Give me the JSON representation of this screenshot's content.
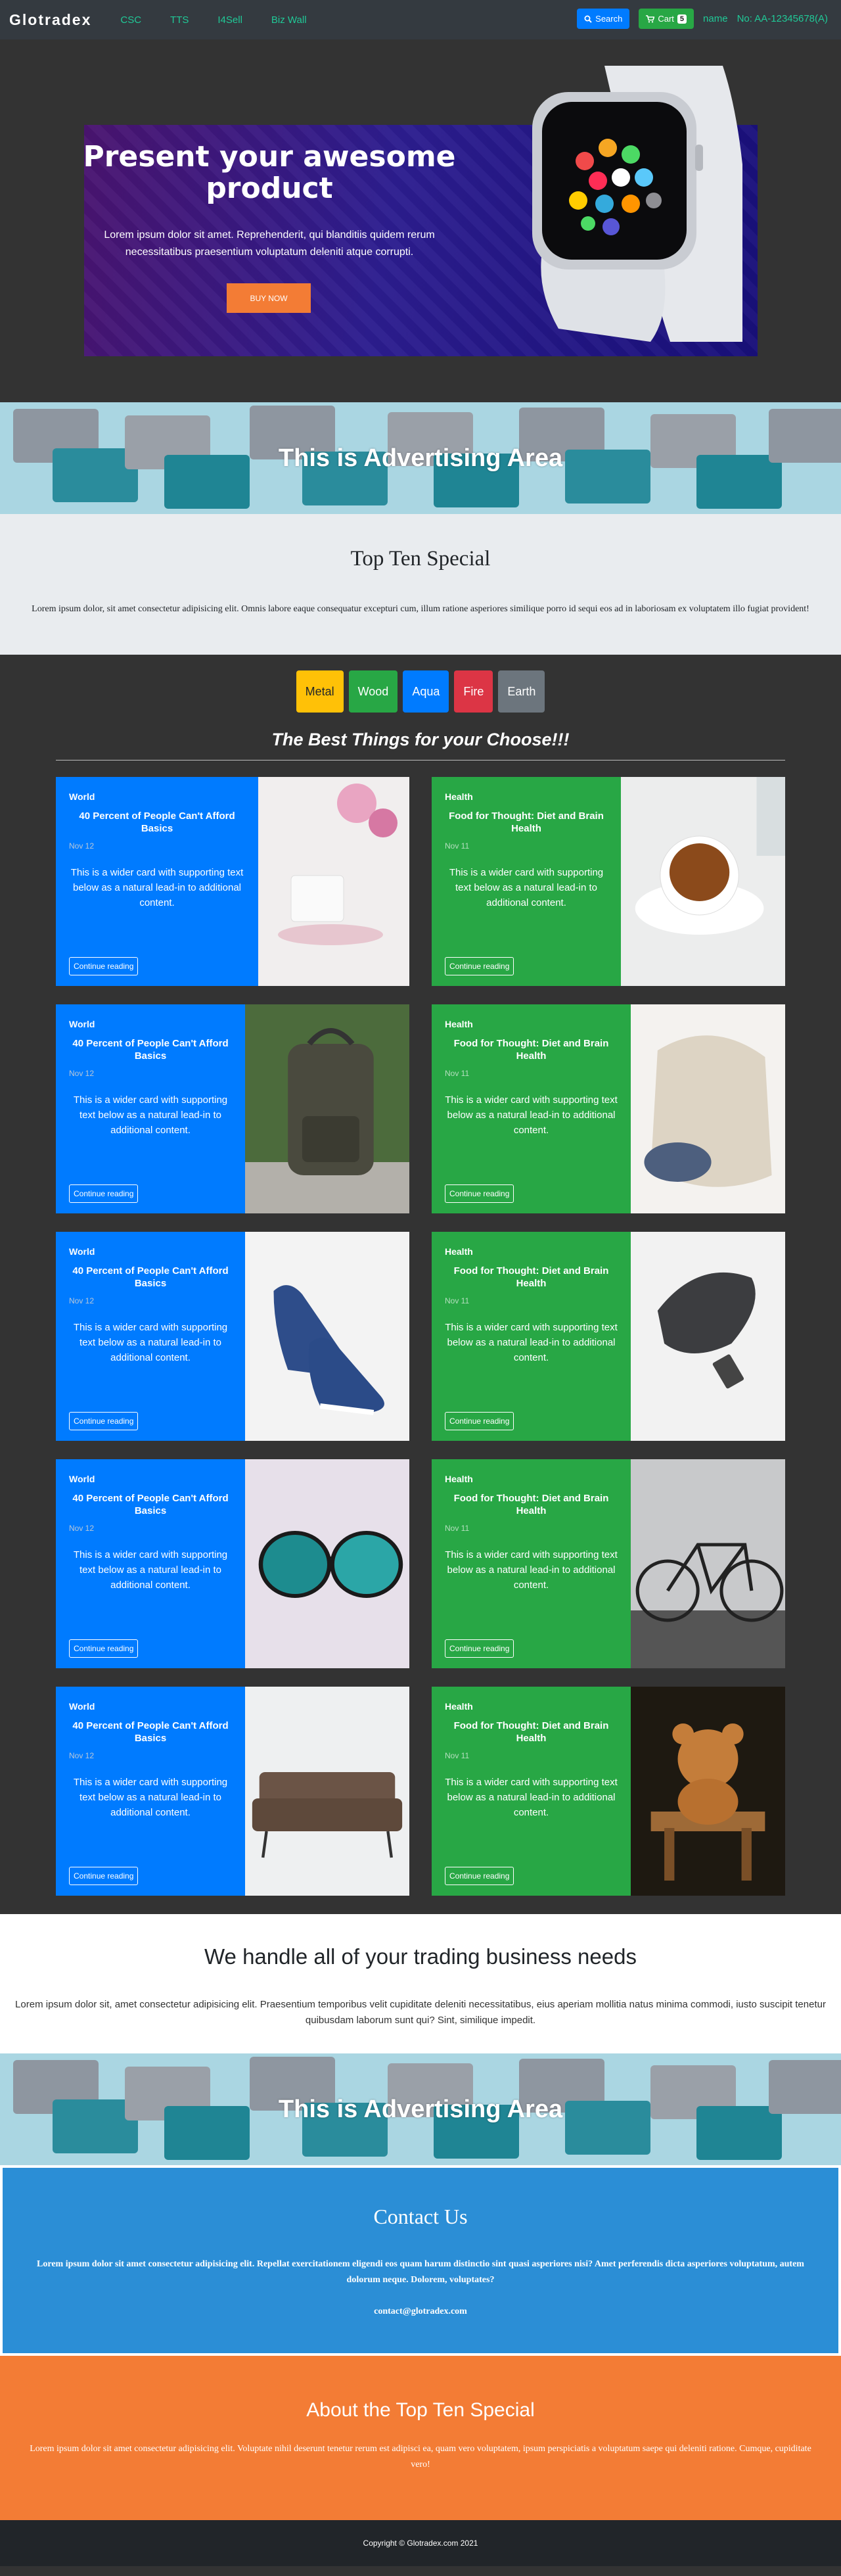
{
  "nav": {
    "brand": "Glotradex",
    "links": [
      "CSC",
      "TTS",
      "I4Sell",
      "Biz Wall"
    ],
    "search_label": "Search",
    "cart_label": "Cart",
    "cart_count": "5",
    "user_name": "name",
    "account_no": "No: AA-12345678(A)"
  },
  "hero": {
    "title": "Present your awesome product",
    "text": "Lorem ipsum dolor sit amet. Reprehenderit, qui blanditiis quidem rerum necessitatibus praesentium voluptatum deleniti atque corrupti.",
    "button": "BUY NOW"
  },
  "ad": {
    "title": "This is Advertising Area"
  },
  "topten": {
    "title": "Top Ten Special",
    "text": "Lorem ipsum dolor, sit amet consectetur adipisicing elit. Omnis labore eaque consequatur excepturi cum, illum ratione asperiores similique porro id sequi eos ad in laboriosam ex voluptatem illo fugiat provident!"
  },
  "tags": [
    {
      "label": "Metal",
      "color": "#ffc107",
      "text": "#212529"
    },
    {
      "label": "Wood",
      "color": "#28a745",
      "text": "#ffffff"
    },
    {
      "label": "Aqua",
      "color": "#007bff",
      "text": "#ffffff"
    },
    {
      "label": "Fire",
      "color": "#dc3545",
      "text": "#ffffff"
    },
    {
      "label": "Earth",
      "color": "#6c757d",
      "text": "#ffffff"
    }
  ],
  "best_title": "The Best Things for your Choose!!!",
  "cards": [
    {
      "category": "World",
      "title": "40 Percent of People Can't Afford Basics",
      "date": "Nov 12",
      "text": "This is a wider card with supporting text below as a natural lead-in to additional content.",
      "button": "Continue reading",
      "image": "cup-photo"
    },
    {
      "category": "Health",
      "title": "Food for Thought: Diet and Brain Health",
      "date": "Nov 11",
      "text": "This is a wider card with supporting text below as a natural lead-in to additional content.",
      "button": "Continue reading",
      "image": "tea-photo"
    },
    {
      "category": "World",
      "title": "40 Percent of People Can't Afford Basics",
      "date": "Nov 12",
      "text": "This is a wider card with supporting text below as a natural lead-in to additional content.",
      "button": "Continue reading",
      "image": "backpack-photo"
    },
    {
      "category": "Health",
      "title": "Food for Thought: Diet and Brain Health",
      "date": "Nov 11",
      "text": "This is a wider card with supporting text below as a natural lead-in to additional content.",
      "button": "Continue reading",
      "image": "bag-photo"
    },
    {
      "category": "World",
      "title": "40 Percent of People Can't Afford Basics",
      "date": "Nov 12",
      "text": "This is a wider card with supporting text below as a natural lead-in to additional content.",
      "button": "Continue reading",
      "image": "shoes-photo"
    },
    {
      "category": "Health",
      "title": "Food for Thought: Diet and Brain Health",
      "date": "Nov 11",
      "text": "This is a wider card with supporting text below as a natural lead-in to additional content.",
      "button": "Continue reading",
      "image": "mouse-photo"
    },
    {
      "category": "World",
      "title": "40 Percent of People Can't Afford Basics",
      "date": "Nov 12",
      "text": "This is a wider card with supporting text below as a natural lead-in to additional content.",
      "button": "Continue reading",
      "image": "sunglasses-photo"
    },
    {
      "category": "Health",
      "title": "Food for Thought: Diet and Brain Health",
      "date": "Nov 11",
      "text": "This is a wider card with supporting text below as a natural lead-in to additional content.",
      "button": "Continue reading",
      "image": "bicycle-photo"
    },
    {
      "category": "World",
      "title": "40 Percent of People Can't Afford Basics",
      "date": "Nov 12",
      "text": "This is a wider card with supporting text below as a natural lead-in to additional content.",
      "button": "Continue reading",
      "image": "sofa-photo"
    },
    {
      "category": "Health",
      "title": "Food for Thought: Diet and Brain Health",
      "date": "Nov 11",
      "text": "This is a wider card with supporting text below as a natural lead-in to additional content.",
      "button": "Continue reading",
      "image": "teddy-bear-photo"
    }
  ],
  "trade": {
    "title": "We handle all of your trading business needs",
    "text": "Lorem ipsum dolor sit, amet consectetur adipisicing elit. Praesentium temporibus velit cupiditate deleniti necessitatibus, eius aperiam mollitia natus minima commodi, iusto suscipit tenetur quibusdam laborum sunt qui? Sint, similique impedit."
  },
  "contact": {
    "title": "Contact Us",
    "text": "Lorem ipsum dolor sit amet consectetur adipisicing elit. Repellat exercitationem eligendi eos quam harum distinctio sint quasi asperiores nisi? Amet perferendis dicta asperiores voluptatum, autem dolorum neque. Dolorem, voluptates?",
    "email": "contact@glotradex.com"
  },
  "about": {
    "title": "About the Top Ten Special",
    "text": "Lorem ipsum dolor sit amet consectetur adipisicing elit. Voluptate nihil deserunt tenetur rerum est adipisci ea, quam vero voluptatem, ipsum perspiciatis a voluptatum saepe qui deleniti ratione. Cumque, cupiditate vero!"
  },
  "footer": "Copyright © Glotradex.com 2021"
}
